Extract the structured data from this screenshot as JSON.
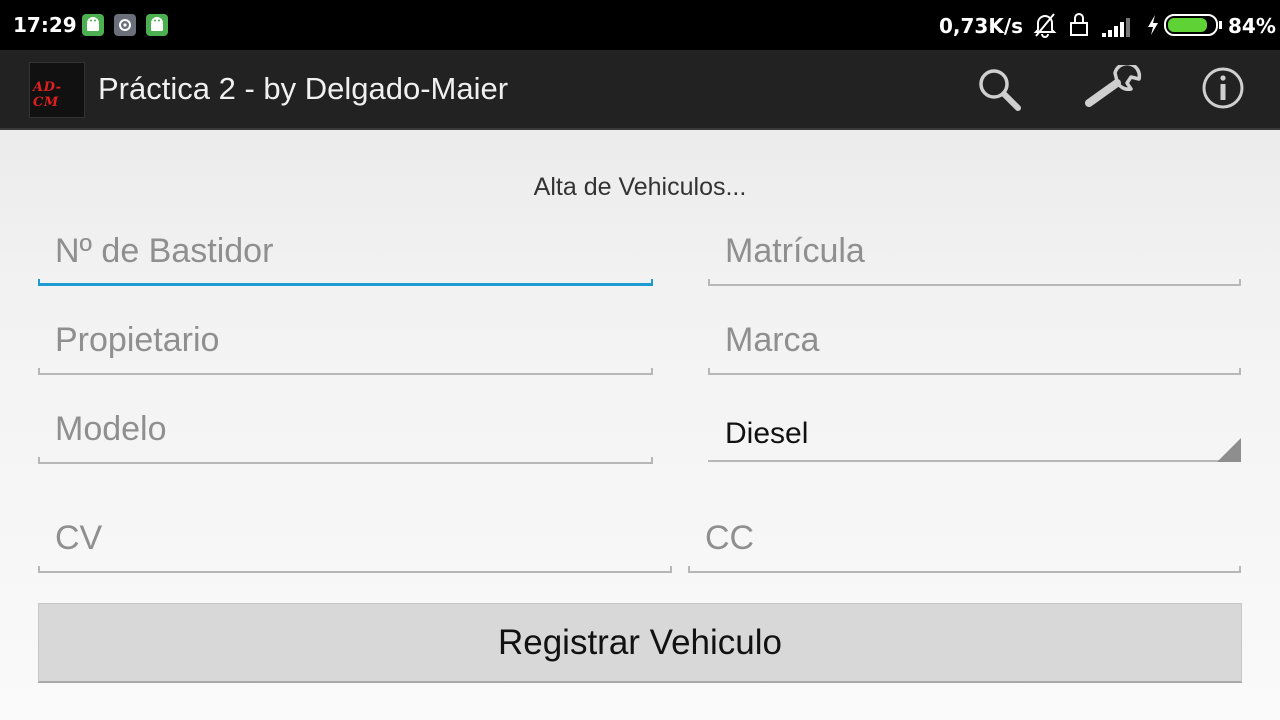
{
  "status_bar": {
    "time": "17:29",
    "notification_icons": [
      "android-icon",
      "settings-icon",
      "android-icon"
    ],
    "net_speed": "0,73K/s",
    "battery_percent": "84%",
    "battery_level": 0.84
  },
  "action_bar": {
    "logo_text": "AD-CM",
    "title": "Práctica 2 - by Delgado-Maier",
    "actions": [
      "search-icon",
      "wrench-icon",
      "info-icon"
    ]
  },
  "form": {
    "heading": "Alta de Vehiculos...",
    "fields": {
      "bastidor": "Nº de Bastidor",
      "matricula": "Matrícula",
      "propietario": "Propietario",
      "marca": "Marca",
      "modelo": "Modelo",
      "cv": "CV",
      "cc": "CC"
    },
    "fuel_selected": "Diesel",
    "submit_label": "Registrar Vehiculo"
  },
  "colors": {
    "focus_accent": "#1f9bd1",
    "action_bar": "#222222",
    "battery_green": "#5fd235"
  }
}
